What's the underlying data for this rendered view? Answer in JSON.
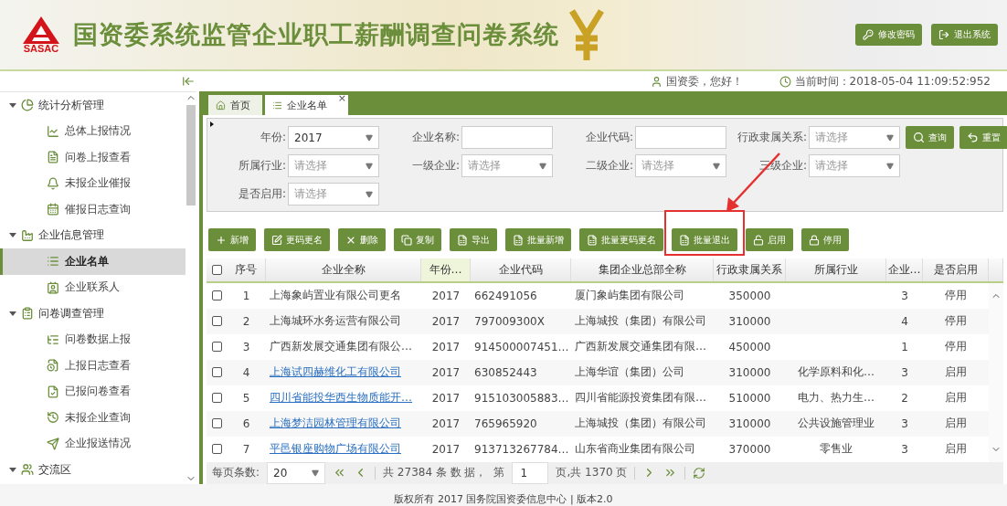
{
  "header": {
    "logo_text": "SASAC",
    "title": "国资委系统监管企业职工薪酬调查问卷系统",
    "buttons": [
      {
        "label": "修改密码",
        "kind": "key"
      },
      {
        "label": "退出系统",
        "kind": "logout"
      }
    ]
  },
  "topbar": {
    "greeting": "国资委，您好！",
    "time": "当前时间：2018-05-04 11:09:52:952"
  },
  "sidebar": {
    "groups": [
      {
        "label": "统计分析管理",
        "expanded": true,
        "children": [
          {
            "label": "总体上报情况",
            "selected": false
          },
          {
            "label": "问卷上报查看",
            "selected": false
          },
          {
            "label": "未报企业催报",
            "selected": false
          },
          {
            "label": "催报日志查询",
            "selected": false
          }
        ]
      },
      {
        "label": "企业信息管理",
        "expanded": true,
        "children": [
          {
            "label": "企业名单",
            "selected": true
          },
          {
            "label": "企业联系人",
            "selected": false
          }
        ]
      },
      {
        "label": "问卷调查管理",
        "expanded": true,
        "children": [
          {
            "label": "问卷数据上报",
            "selected": false
          },
          {
            "label": "上报日志查看",
            "selected": false
          },
          {
            "label": "已报问卷查看",
            "selected": false
          },
          {
            "label": "未报企业查询",
            "selected": false
          },
          {
            "label": "企业报送情况",
            "selected": false
          }
        ]
      },
      {
        "label": "交流区",
        "expanded": true
      }
    ]
  },
  "tabs": [
    {
      "label": "首页",
      "kind": "home",
      "selected": false
    },
    {
      "label": "企业名单",
      "kind": "page",
      "selected": true,
      "close": "×"
    }
  ],
  "filters": [
    {
      "label": "年份:",
      "kind": "select",
      "value": "2017"
    },
    {
      "label": "企业名称:",
      "kind": "input"
    },
    {
      "label": "企业代码:",
      "kind": "input"
    },
    {
      "label": "行政隶属关系:",
      "kind": "select",
      "placeholder": "请选择"
    },
    {
      "label": "所属行业:",
      "kind": "select",
      "placeholder": "请选择"
    },
    {
      "label": "一级企业:",
      "kind": "select",
      "placeholder": "请选择"
    },
    {
      "label": "二级企业:",
      "kind": "select",
      "placeholder": "请选择"
    },
    {
      "label": "三级企业:",
      "kind": "select",
      "placeholder": "请选择"
    },
    {
      "label": "是否启用:",
      "kind": "select",
      "placeholder": "请选择"
    }
  ],
  "filter_buttons": [
    {
      "label": "查询",
      "kind": "search"
    },
    {
      "label": "重置",
      "kind": "reset"
    }
  ],
  "toolbar": [
    {
      "label": "新增",
      "kind": "plus",
      "highlighted": false
    },
    {
      "label": "更码更名",
      "kind": "edit",
      "highlighted": false
    },
    {
      "label": "删除",
      "kind": "delete",
      "highlighted": false
    },
    {
      "label": "复制",
      "kind": "copy",
      "highlighted": false
    },
    {
      "label": "导出",
      "kind": "excel",
      "highlighted": false
    },
    {
      "label": "批量新增",
      "kind": "excel",
      "highlighted": false
    },
    {
      "label": "批量更码更名",
      "kind": "excel",
      "highlighted": false
    },
    {
      "label": "批量退出",
      "kind": "excel",
      "highlighted": true
    },
    {
      "label": "启用",
      "kind": "unlock",
      "highlighted": false
    },
    {
      "label": "停用",
      "kind": "lock",
      "highlighted": false
    }
  ],
  "table": {
    "select_all_checked": false,
    "columns": [
      {
        "label": "序号",
        "sorted": false
      },
      {
        "label": "企业全称",
        "sorted": false
      },
      {
        "label": "年份…",
        "sorted": true
      },
      {
        "label": "企业代码",
        "sorted": false
      },
      {
        "label": "集团企业总部全称",
        "sorted": false
      },
      {
        "label": "行政隶属关系",
        "sorted": false
      },
      {
        "label": "所属行业",
        "sorted": false
      },
      {
        "label": "企业…",
        "sorted": false
      },
      {
        "label": "是否启用",
        "sorted": false
      }
    ],
    "rows": [
      {
        "checked": false,
        "kind": "plain",
        "cells": [
          "1",
          "上海象屿置业有限公司更名",
          "2017",
          "662491056",
          "厦门象屿集团有限公司",
          "350000",
          "",
          "3",
          "停用"
        ]
      },
      {
        "checked": false,
        "kind": "plain",
        "cells": [
          "2",
          "上海城环水务运营有限公司",
          "2017",
          "797009300X",
          "上海城投（集团）有限公司",
          "310000",
          "",
          "4",
          "停用"
        ]
      },
      {
        "checked": false,
        "kind": "plain",
        "cells": [
          "3",
          "广西新发展交通集团有限公…",
          "2017",
          "914500007451…",
          "广西新发展交通集团有限…",
          "450000",
          "",
          "1",
          "停用"
        ]
      },
      {
        "checked": false,
        "kind": "link",
        "cells": [
          "4",
          "上海试四赫维化工有限公司",
          "2017",
          "630852443",
          "上海华谊（集团）公司",
          "310000",
          "化学原料和化…",
          "3",
          "启用"
        ]
      },
      {
        "checked": false,
        "kind": "link",
        "cells": [
          "5",
          "四川省能投华西生物质能开…",
          "2017",
          "915103005883…",
          "四川省能源投资集团有限…",
          "510000",
          "电力、热力生…",
          "2",
          "启用"
        ]
      },
      {
        "checked": false,
        "kind": "link",
        "cells": [
          "6",
          "上海梦洁园林管理有限公司",
          "2017",
          "765965920",
          "上海城投（集团）有限公司",
          "310000",
          "公共设施管理业",
          "3",
          "启用"
        ]
      },
      {
        "checked": false,
        "kind": "link",
        "cells": [
          "7",
          "平邑银座购物广场有限公司",
          "2017",
          "913713267784…",
          "山东省商业集团有限公司",
          "370000",
          "零售业",
          "3",
          "启用"
        ]
      }
    ]
  },
  "pagination": {
    "page_size_label": "每页条数:",
    "page_size": "20",
    "total": "共 27384 条 数 据，",
    "page_label": "第",
    "page": "1",
    "pages": "页,共 1370 页"
  },
  "footer": "版权所有 2017 国务院国资委信息中心 | 版本2.0"
}
